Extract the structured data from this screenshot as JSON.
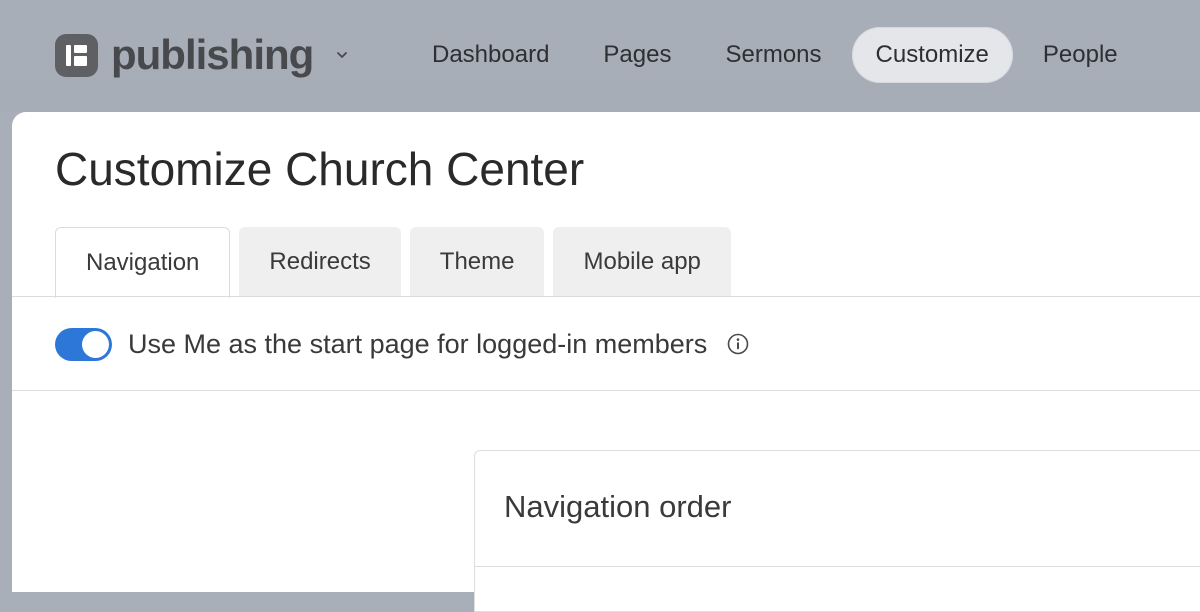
{
  "app": {
    "name": "publishing",
    "logo_icon": "publishing-logo-icon",
    "switcher_icon": "chevron-down-icon"
  },
  "topnav": {
    "items": [
      {
        "label": "Dashboard"
      },
      {
        "label": "Pages"
      },
      {
        "label": "Sermons"
      },
      {
        "label": "Customize",
        "active": true
      },
      {
        "label": "People"
      }
    ]
  },
  "page": {
    "title": "Customize Church Center"
  },
  "tabs": [
    {
      "label": "Navigation",
      "active": true
    },
    {
      "label": "Redirects"
    },
    {
      "label": "Theme"
    },
    {
      "label": "Mobile app"
    }
  ],
  "settings": {
    "start_page_toggle": {
      "label": "Use Me as the start page for logged-in members",
      "enabled": true,
      "info_icon": "info-icon"
    }
  },
  "navigation_order": {
    "title": "Navigation order"
  },
  "colors": {
    "toggle_on": "#2d77d8",
    "topbar_bg": "#a9afb8",
    "active_nav_bg": "#e4e6ea"
  }
}
